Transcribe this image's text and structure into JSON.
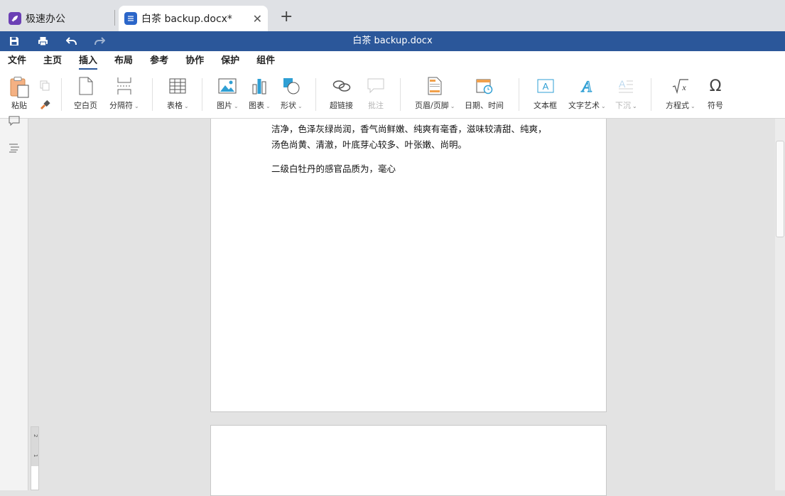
{
  "tabs": {
    "app": {
      "label": "极速办公",
      "icon": "rocket-icon"
    },
    "doc": {
      "label": "白茶 backup.docx*",
      "icon": "document-icon",
      "close": "✕"
    },
    "new": "+"
  },
  "titlebar": {
    "title": "白茶 backup.docx",
    "quick_actions": [
      "save-icon",
      "print-icon",
      "undo-icon",
      "redo-icon"
    ]
  },
  "menus": [
    "文件",
    "主页",
    "插入",
    "布局",
    "参考",
    "协作",
    "保护",
    "组件"
  ],
  "active_menu": "插入",
  "ribbon": {
    "paste": "粘贴",
    "blank_page": "空白页",
    "section_break": "分隔符",
    "table": "表格",
    "picture": "图片",
    "chart": "图表",
    "shape": "形状",
    "hyperlink": "超链接",
    "comment": "批注",
    "header_footer": "页眉/页脚",
    "date_time": "日期、时间",
    "text_box": "文本框",
    "word_art": "文字艺术",
    "drop_cap": "下沉",
    "equation": "方程式",
    "symbol": "符号"
  },
  "document": {
    "para1_line1": "洁净，色泽灰绿尚润，香气尚鲜嫩、纯爽有毫香，滋味较清甜、纯爽，",
    "para1_line2": "汤色尚黄、清澈，叶底芽心较多、叶张嫩、尚明。",
    "para2": "二级白牡丹的感官品质为，毫心"
  },
  "ruler": {
    "marks": [
      "2",
      "1"
    ]
  },
  "colors": {
    "brand": "#2b579a",
    "app_icon": "#6b3fb5",
    "doc_icon": "#2b66c9"
  }
}
